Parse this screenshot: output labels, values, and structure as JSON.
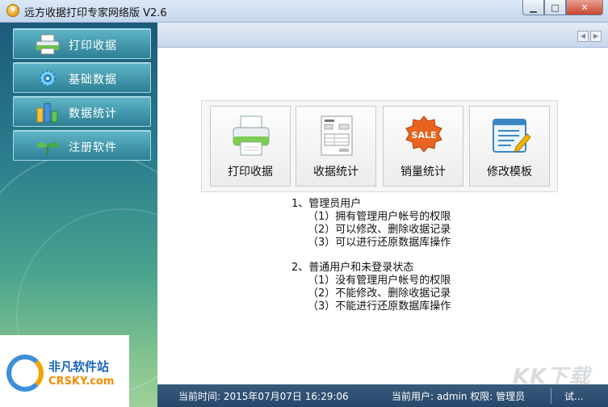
{
  "window": {
    "title": "远方收据打印专家网络版 V2.6",
    "min": "▁",
    "max": "□",
    "close": "✕",
    "app_icon": "¥"
  },
  "sidebar": {
    "items": [
      {
        "label": "打印收据",
        "icon": "printer-icon"
      },
      {
        "label": "基础数据",
        "icon": "gear-icon"
      },
      {
        "label": "数据统计",
        "icon": "bar-chart-icon"
      },
      {
        "label": "注册软件",
        "icon": "sprout-icon"
      }
    ]
  },
  "logo": {
    "name_cn": "非凡软件站",
    "name_en": "CRSKY.com"
  },
  "toolbar": {
    "prev": "◀",
    "next": "▶"
  },
  "tiles": [
    {
      "label": "打印收据",
      "icon": "printer-icon"
    },
    {
      "label": "收据统计",
      "icon": "invoice-icon"
    },
    {
      "label": "销量统计",
      "icon": "sale-badge-icon",
      "badge": "SALE"
    },
    {
      "label": "修改模板",
      "icon": "edit-document-icon"
    }
  ],
  "description": {
    "section1": {
      "title": "1、管理员用户",
      "lines": [
        "（1）拥有管理用户帐号的权限",
        "（2）可以修改、删除收据记录",
        "（3）可以进行还原数据库操作"
      ]
    },
    "section2": {
      "title": "2、普通用户和未登录状态",
      "lines": [
        "（1）没有管理用户帐号的权限",
        "（2）不能修改、删除收据记录",
        "（3）不能进行还原数据库操作"
      ]
    }
  },
  "status": {
    "time": "当前时间: 2015年07月07日 16:29:06",
    "user": "当前用户: admin   权限: 管理员",
    "mode": "试..."
  },
  "watermark": "KK下载",
  "colors": {
    "sidebar_top": "#1c5a7a",
    "sidebar_bottom": "#9fd19a",
    "status_bar": "#27486a",
    "nav_button": "#2e7f95"
  }
}
